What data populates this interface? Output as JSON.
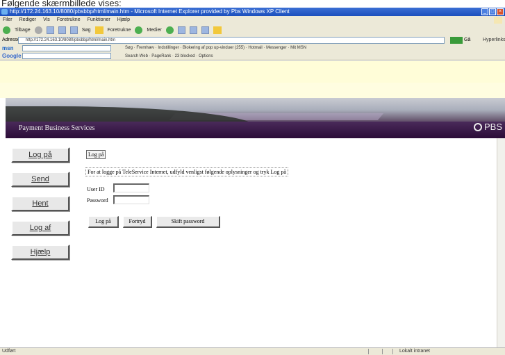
{
  "caption": "Følgende skærmbillede vises:",
  "window": {
    "title": "http://172.24.163.10/8080/pbsbbp/html/main.htm - Microsoft Internet Explorer provided by Pbs Windows XP Client"
  },
  "menubar": {
    "items": [
      "Filer",
      "Rediger",
      "Vis",
      "Foretrukne",
      "Funktioner",
      "Hjælp"
    ]
  },
  "toolbar": {
    "back": "Tilbage",
    "search": "Søg",
    "favorites": "Foretrukne",
    "media": "Medier"
  },
  "address": {
    "label": "Adresse",
    "url": "http://172.24.163.10/8080/pbsbbp/html/main.htm",
    "go": "Gå",
    "links": "Hyperlinks"
  },
  "msn_toolbar": {
    "logo": "msn",
    "items": "Søg  ·  Fremhæv  ·  Indstillinger  ·  Blokering af pop up-vinduer (255)  ·  Hotmail  ·  Messenger  ·  Mit MSN"
  },
  "google_toolbar": {
    "logo": "Google",
    "items": "Search Web  ·  PageRank  ·  23 blocked  ·  Options"
  },
  "banner": {
    "title": "Payment Business Services",
    "logo": "PBS"
  },
  "nav": {
    "items": [
      {
        "label": "Log på"
      },
      {
        "label": "Send"
      },
      {
        "label": "Hent"
      },
      {
        "label": "Log af"
      },
      {
        "label": "Hjælp"
      }
    ]
  },
  "login": {
    "heading": "Log på",
    "instructions": "For at logge på TeleService Internet, udfyld venligst følgende oplysninger og tryk Log på",
    "user_id_label": "User ID",
    "password_label": "Password",
    "user_id_value": "",
    "password_value": "",
    "buttons": {
      "login": "Log på",
      "reset": "Fortryd",
      "change_password": "Skift password"
    }
  },
  "status": {
    "left": "Udført",
    "right": "Lokalt intranet"
  }
}
